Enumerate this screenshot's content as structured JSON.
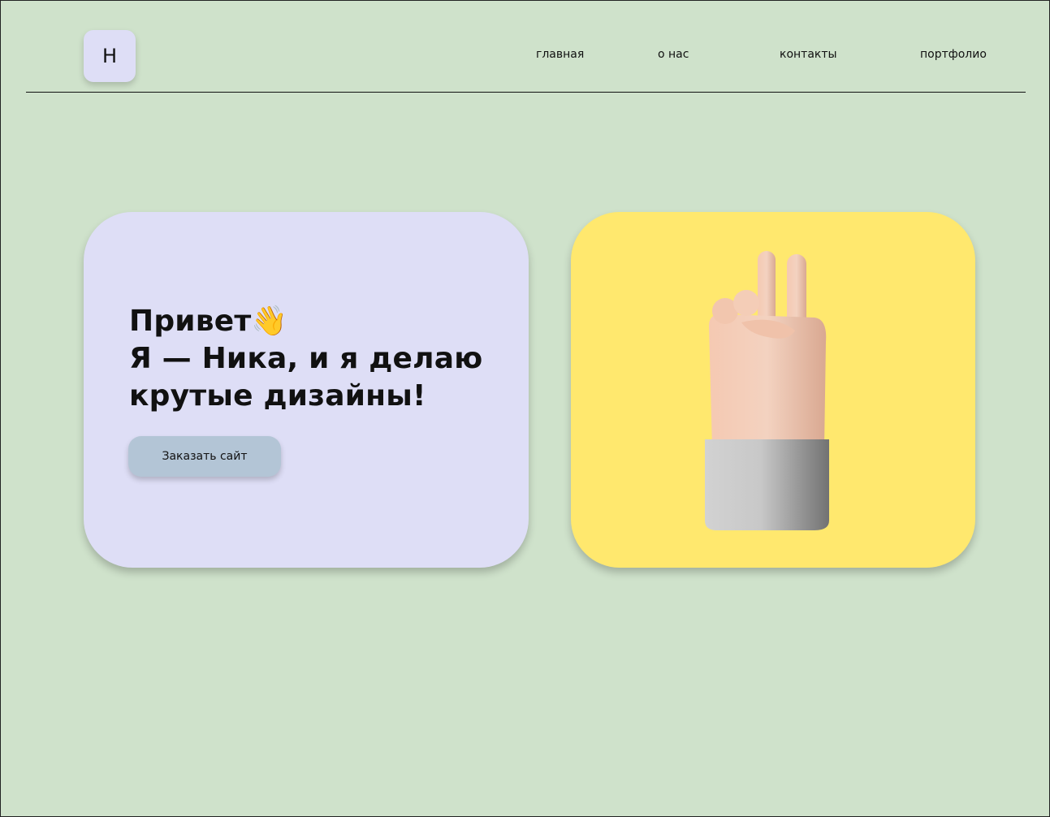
{
  "header": {
    "logo_letter": "Н",
    "nav": [
      {
        "label": "главная"
      },
      {
        "label": "о нас"
      },
      {
        "label": "контакты"
      },
      {
        "label": "портфолио"
      }
    ]
  },
  "hero": {
    "line1": "Привет👋",
    "line2": "Я — Ника, и я делаю",
    "line3": "крутые дизайны!",
    "button_label": "Заказать сайт"
  },
  "colors": {
    "background": "#cfe2cb",
    "card_left": "#dedef6",
    "card_right": "#ffe86e",
    "button": "#b3c5d6"
  },
  "icons": {
    "hand": "peace-hand-icon",
    "wave": "waving-hand-icon"
  }
}
